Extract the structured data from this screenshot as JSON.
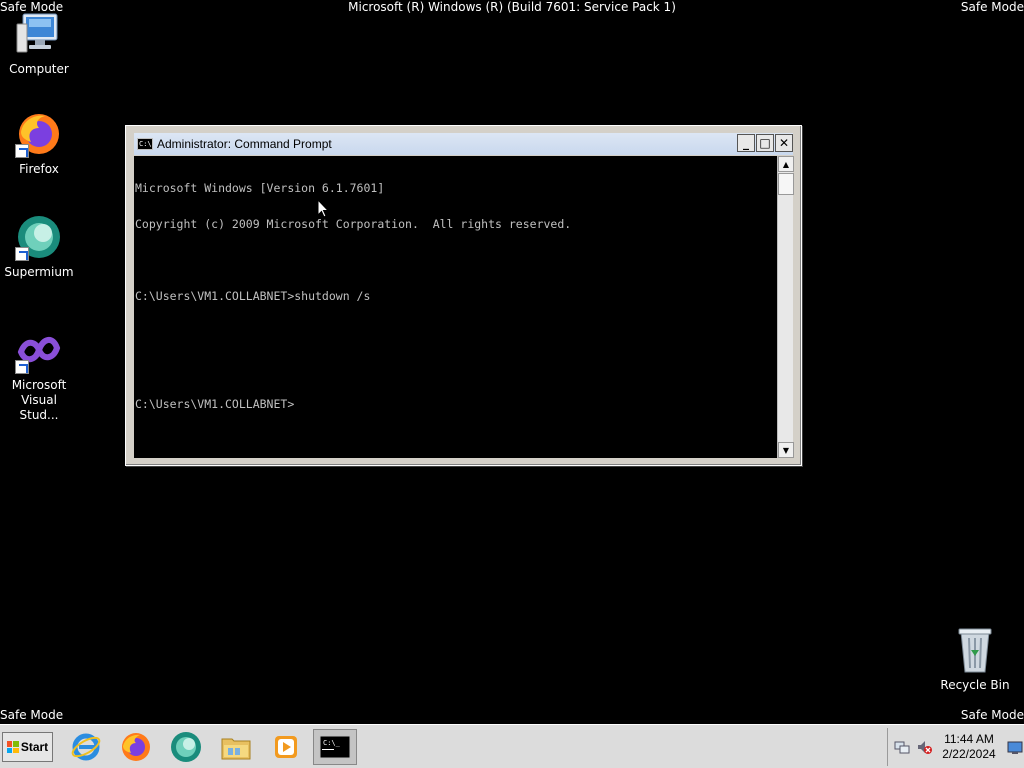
{
  "overlay": {
    "safe_mode": "Safe Mode",
    "build": "Microsoft (R) Windows (R) (Build 7601: Service Pack 1)"
  },
  "desktop": {
    "icons": [
      {
        "label": "Computer",
        "icon": "computer-icon"
      },
      {
        "label": "Firefox",
        "icon": "firefox-icon"
      },
      {
        "label": "Supermium",
        "icon": "supermium-icon"
      },
      {
        "label_line1": "Microsoft",
        "label_line2": "Visual Stud...",
        "icon": "visual-studio-icon"
      }
    ],
    "recycle_bin": {
      "label": "Recycle Bin",
      "icon": "recycle-bin-icon"
    }
  },
  "cmd_window": {
    "title": "Administrator: Command Prompt",
    "icon_text": "C:\\",
    "lines": [
      "Microsoft Windows [Version 6.1.7601]",
      "Copyright (c) 2009 Microsoft Corporation.  All rights reserved.",
      "",
      "C:\\Users\\VM1.COLLABNET>shutdown /s",
      "",
      "",
      "C:\\Users\\VM1.COLLABNET>"
    ],
    "buttons": {
      "minimize": "_",
      "maximize": "□",
      "close": "✕"
    }
  },
  "taskbar": {
    "start_label": "Start",
    "apps": [
      "internet-explorer-icon",
      "firefox-icon",
      "supermium-icon",
      "file-explorer-icon",
      "media-player-icon",
      "command-prompt-icon"
    ],
    "clock": {
      "time": "11:44 AM",
      "date": "2/22/2024"
    }
  },
  "colors": {
    "desktop": "#000000",
    "console_text": "#c0c0c0",
    "taskbar": "#dcdcdc",
    "title_bar": "#dce6f4"
  }
}
